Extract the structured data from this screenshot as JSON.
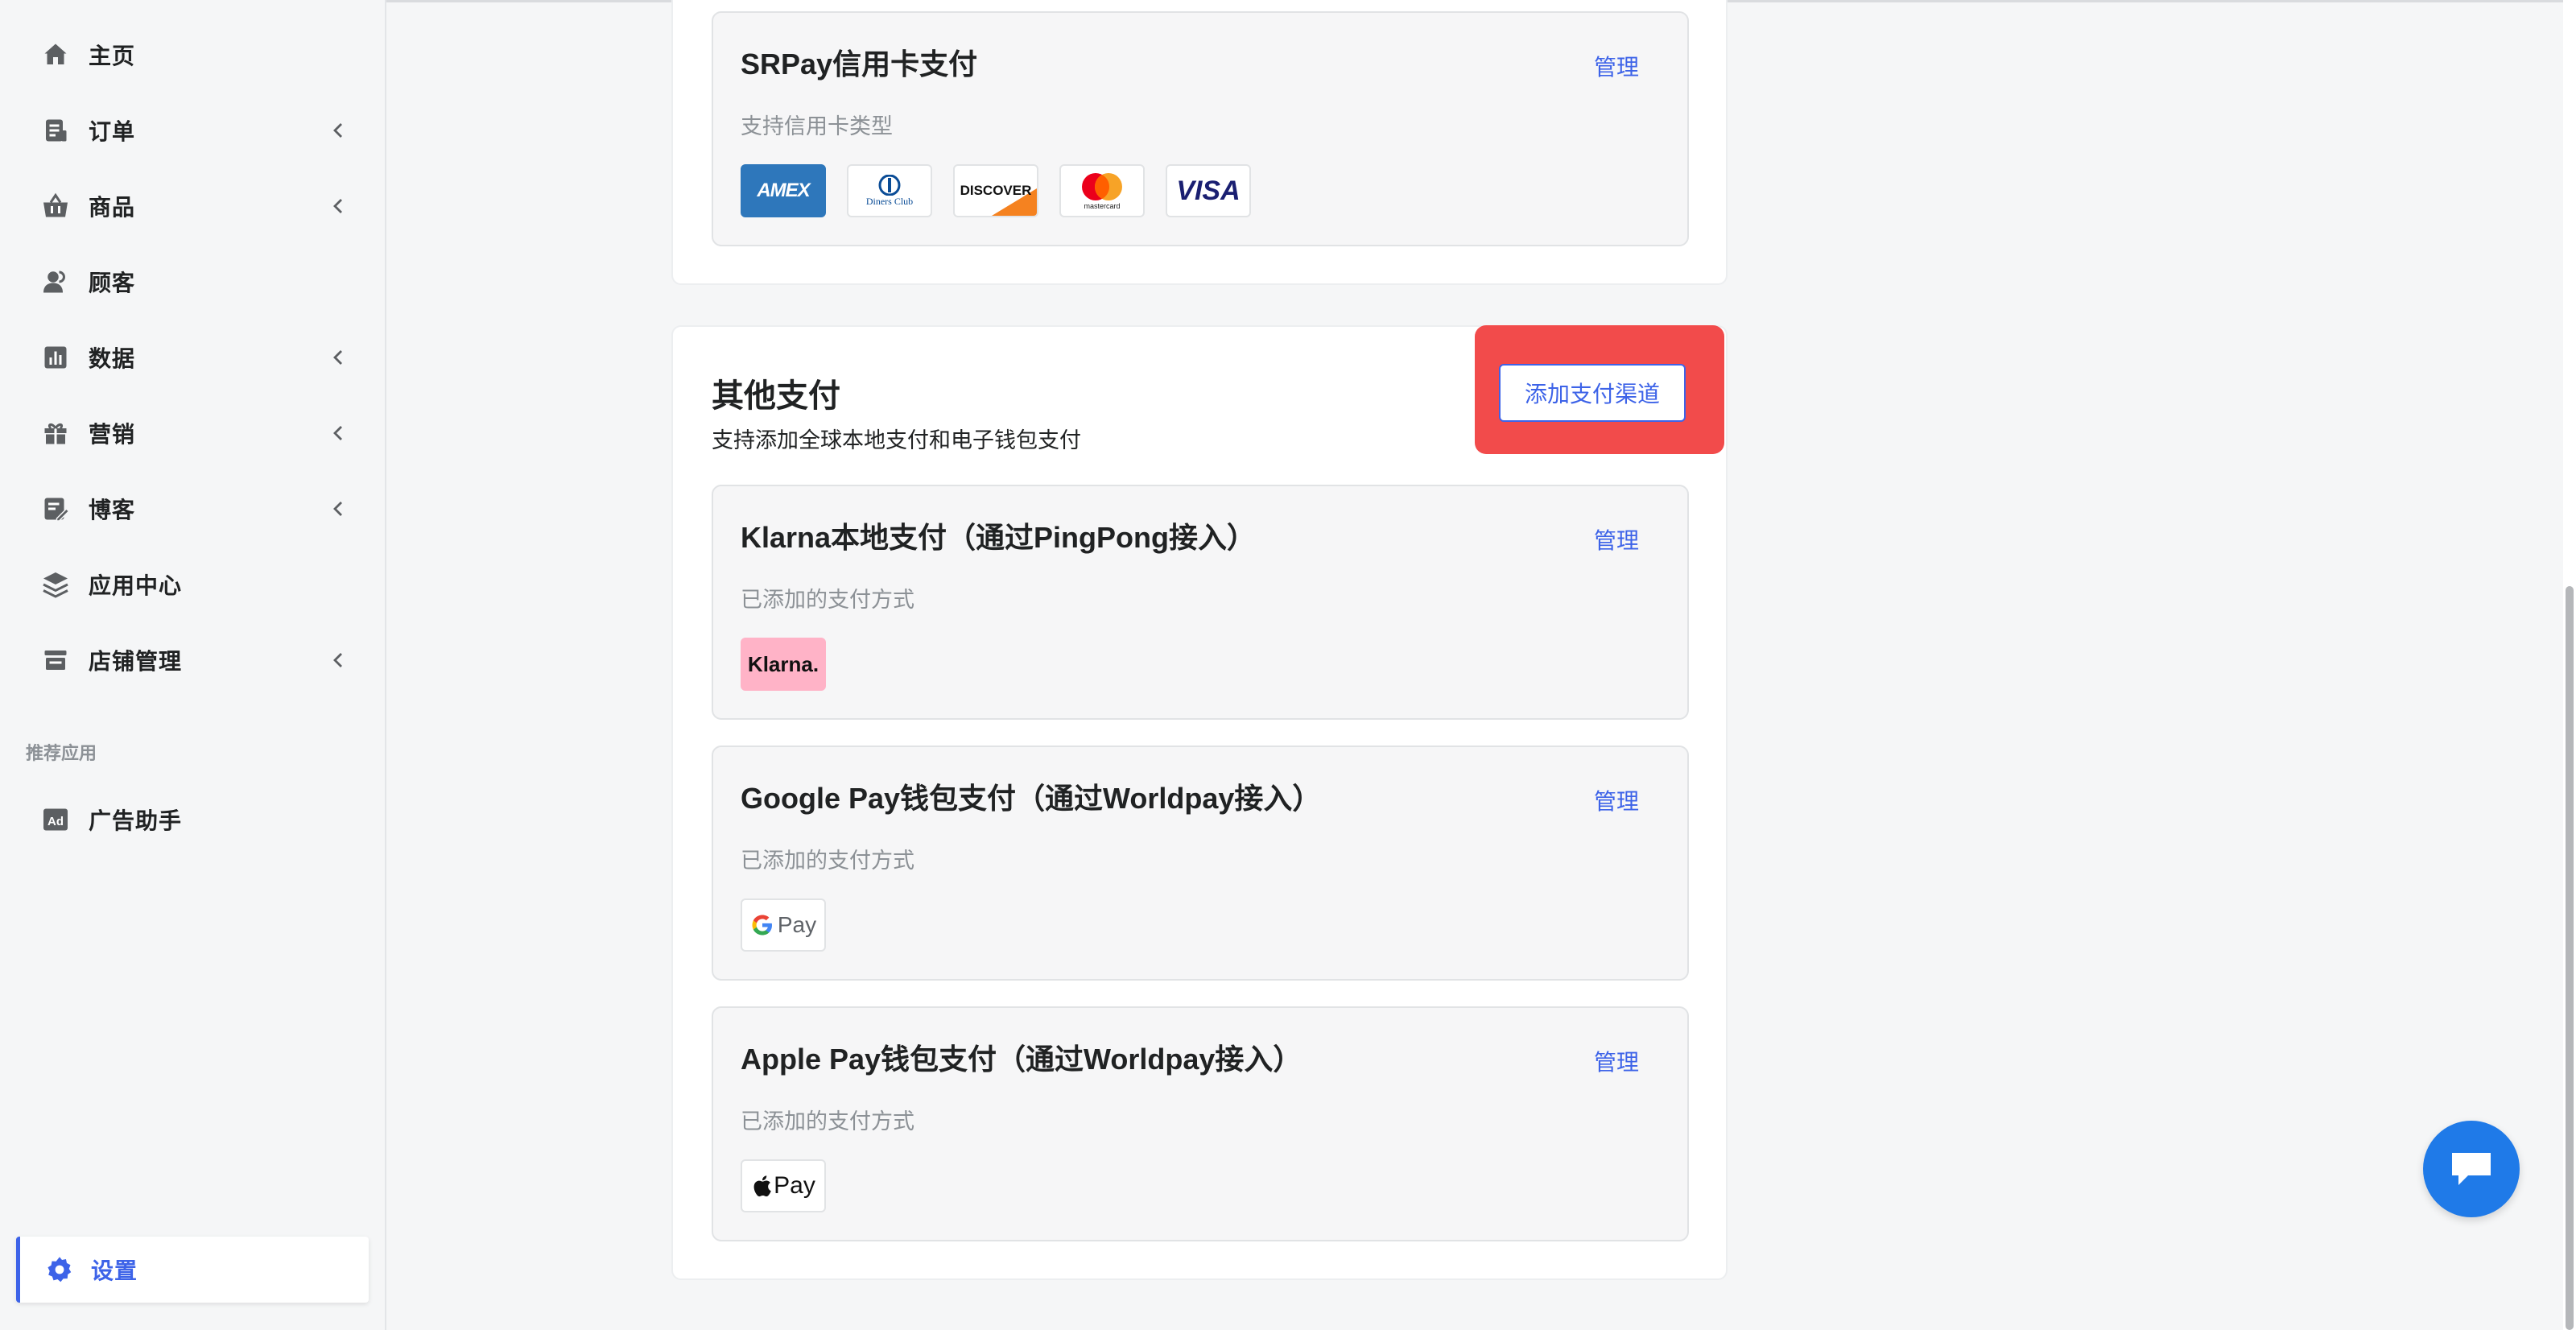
{
  "sidebar": {
    "items": [
      {
        "label": "主页",
        "icon": "home-icon"
      },
      {
        "label": "订单",
        "icon": "order-icon"
      },
      {
        "label": "商品",
        "icon": "basket-icon"
      },
      {
        "label": "顾客",
        "icon": "customers-icon"
      },
      {
        "label": "数据",
        "icon": "bar-chart-icon"
      },
      {
        "label": "营销",
        "icon": "gift-icon"
      },
      {
        "label": "博客",
        "icon": "edit-note-icon"
      },
      {
        "label": "应用中心",
        "icon": "layers-icon"
      },
      {
        "label": "店铺管理",
        "icon": "store-icon"
      }
    ],
    "recommended_label": "推荐应用",
    "recommended": [
      {
        "label": "广告助手",
        "icon": "ad-icon"
      }
    ],
    "active": {
      "label": "设置",
      "icon": "gear-icon"
    }
  },
  "srpay": {
    "title": "SRPay信用卡支付",
    "manage": "管理",
    "subtitle": "支持信用卡类型",
    "cards": [
      "AMEX",
      "Diners Club",
      "DISCOVER",
      "mastercard",
      "VISA"
    ]
  },
  "other": {
    "title": "其他支付",
    "description": "支持添加全球本地支付和电子钱包支付",
    "add_button": "添加支付渠道",
    "methods": [
      {
        "title": "Klarna本地支付（通过PingPong接入）",
        "manage": "管理",
        "subtitle": "已添加的支付方式",
        "logo": "Klarna."
      },
      {
        "title": "Google Pay钱包支付（通过Worldpay接入）",
        "manage": "管理",
        "subtitle": "已添加的支付方式",
        "logo": "Pay"
      },
      {
        "title": "Apple Pay钱包支付（通过Worldpay接入）",
        "manage": "管理",
        "subtitle": "已添加的支付方式",
        "logo": "Pay"
      }
    ]
  },
  "colors": {
    "accent": "#3d63e8",
    "highlight": "#f24b4b",
    "chat": "#1f7ae8",
    "klarna": "#ffb3c7"
  }
}
